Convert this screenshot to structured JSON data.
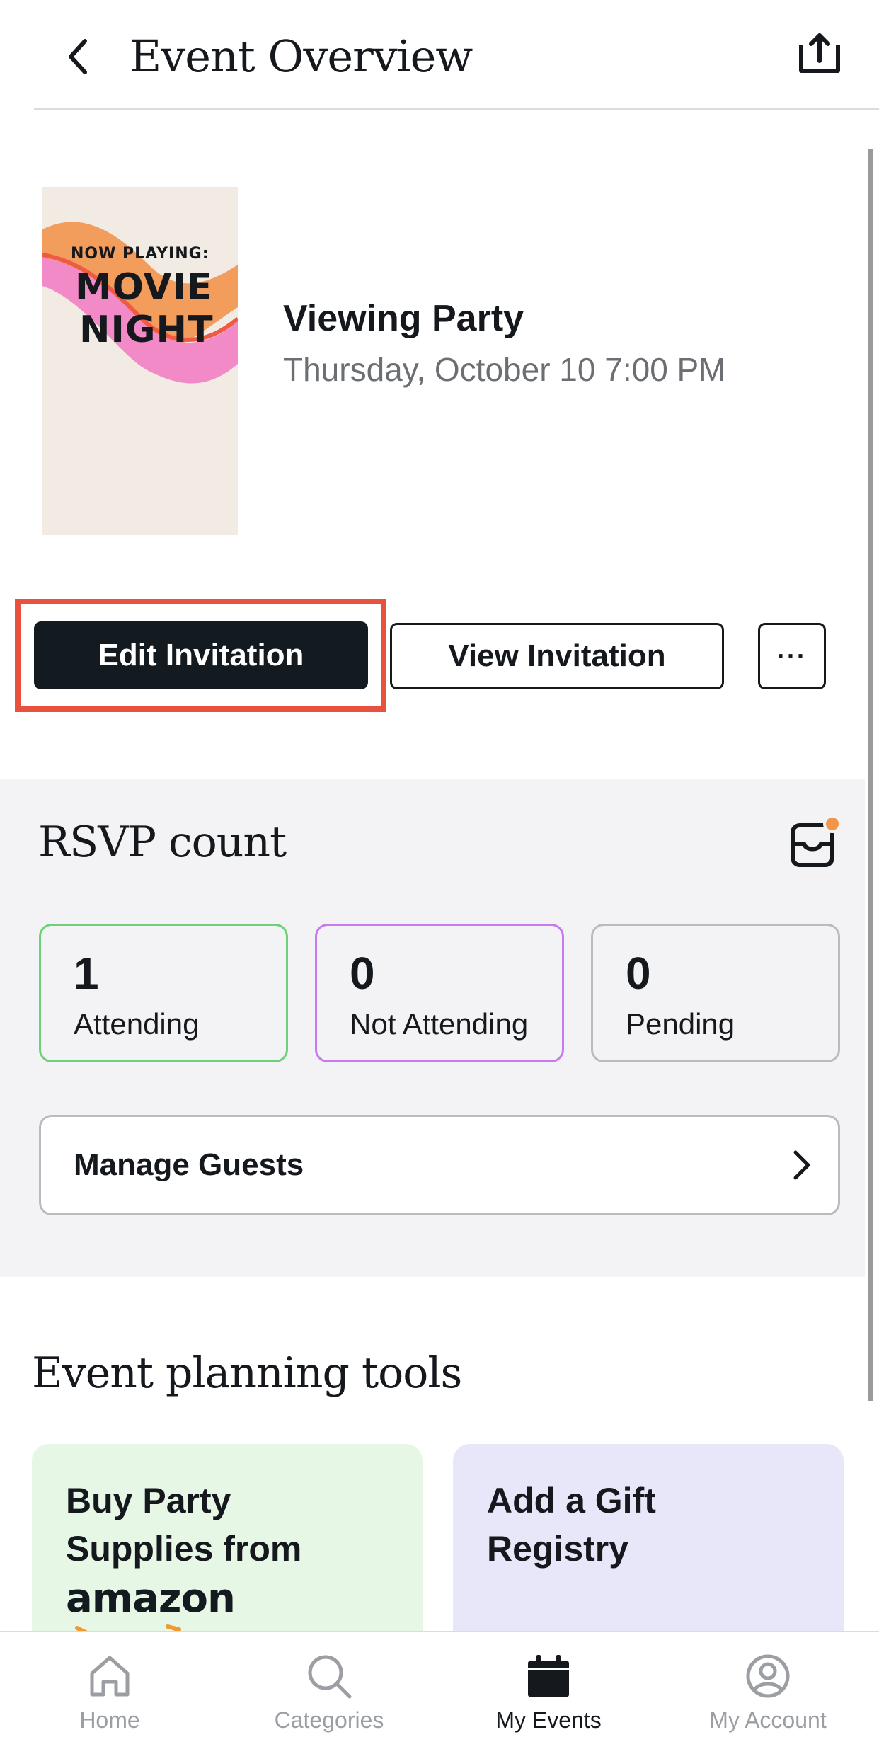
{
  "header": {
    "title": "Event Overview"
  },
  "event": {
    "poster_top": "NOW PLAYING:",
    "poster_line1": "MOVIE",
    "poster_line2": "NIGHT",
    "name": "Viewing Party",
    "datetime": "Thursday, October 10 7:00 PM"
  },
  "actions": {
    "edit_label": "Edit Invitation",
    "view_label": "View Invitation",
    "more_label": "···"
  },
  "rsvp": {
    "title": "RSVP count",
    "counts": [
      {
        "value": "1",
        "label": "Attending"
      },
      {
        "value": "0",
        "label": "Not Attending"
      },
      {
        "value": "0",
        "label": "Pending"
      }
    ],
    "manage_label": "Manage Guests"
  },
  "tools": {
    "title": "Event planning tools",
    "cards": [
      {
        "label": "Buy Party Supplies from",
        "brand": "amazon"
      },
      {
        "label": "Add a Gift Registry"
      }
    ]
  },
  "nav": {
    "items": [
      {
        "label": "Home",
        "icon": "home-icon"
      },
      {
        "label": "Categories",
        "icon": "search-icon"
      },
      {
        "label": "My Events",
        "icon": "calendar-icon",
        "active": true
      },
      {
        "label": "My Account",
        "icon": "account-icon"
      }
    ]
  },
  "colors": {
    "highlight": "#e8513d",
    "primary": "#131a20",
    "attending_border": "#6fd07c",
    "not_attending_border": "#c77af0",
    "notification_dot": "#f0964a",
    "amazon_card": "#e6f7e6",
    "registry_card": "#e8e7fa"
  }
}
